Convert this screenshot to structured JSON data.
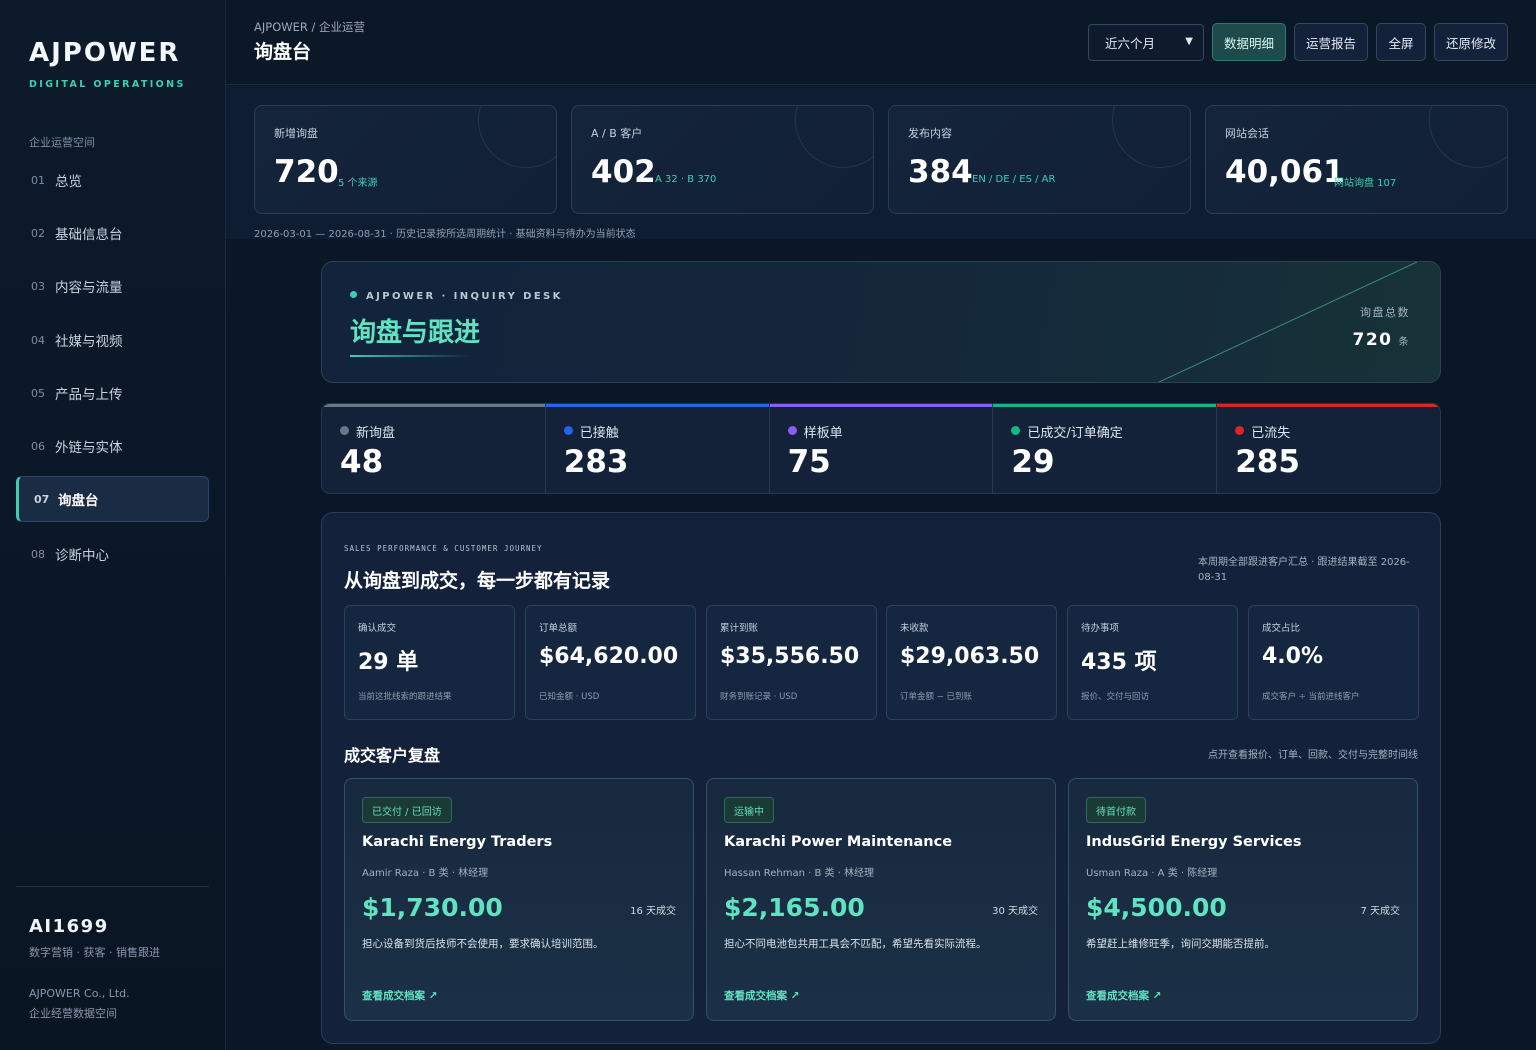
{
  "sidebar": {
    "brand": "AJPOWER",
    "brand_sub": "DIGITAL OPERATIONS",
    "group_label": "企业运营空间",
    "items": [
      {
        "num": "01",
        "label": "总览"
      },
      {
        "num": "02",
        "label": "基础信息台"
      },
      {
        "num": "03",
        "label": "内容与流量"
      },
      {
        "num": "04",
        "label": "社媒与视频"
      },
      {
        "num": "05",
        "label": "产品与上传"
      },
      {
        "num": "06",
        "label": "外链与实体"
      },
      {
        "num": "07",
        "label": "询盘台",
        "active": true
      },
      {
        "num": "08",
        "label": "诊断中心"
      }
    ],
    "user": "AI1699",
    "user_sub": "数字营销 · 获客 · 销售跟进",
    "company": "AJPOWER Co., Ltd.",
    "company_sub": "企业经营数据空间"
  },
  "header": {
    "breadcrumb": "AJPOWER / 企业运营",
    "title": "询盘台",
    "range_select": "近六个月",
    "buttons": [
      "数据明细",
      "运营报告",
      "全屏",
      "还原修改"
    ]
  },
  "stats": [
    {
      "label": "新增询盘",
      "value": "720",
      "sub": "5 个来源"
    },
    {
      "label": "A / B 客户",
      "value": "402",
      "sub": "A 32 · B 370"
    },
    {
      "label": "发布内容",
      "value": "384",
      "sub": "EN / DE / ES / AR"
    },
    {
      "label": "网站会话",
      "value": "40,061",
      "sub": "网站询盘 107"
    }
  ],
  "range_note": "2026-03-01 — 2026-08-31 · 历史记录按所选周期统计 · 基础资料与待办为当前状态",
  "hero": {
    "tag": "AJPOWER · INQUIRY DESK",
    "title": "询盘与跟进",
    "right_label": "询盘总数",
    "right_value": "720",
    "right_unit": "条"
  },
  "pipeline": [
    {
      "label": "新询盘",
      "value": "48",
      "color": "#6b7787"
    },
    {
      "label": "已接触",
      "value": "283",
      "color": "#2563eb"
    },
    {
      "label": "样板单",
      "value": "75",
      "color": "#8b5cf6"
    },
    {
      "label": "已成交/订单确定",
      "value": "29",
      "color": "#10b981"
    },
    {
      "label": "已流失",
      "value": "285",
      "color": "#dc2626"
    }
  ],
  "performance": {
    "eyebrow": "SALES PERFORMANCE & CUSTOMER JOURNEY",
    "title": "从询盘到成交，每一步都有记录",
    "note": "本周期全部跟进客户汇总 · 跟进结果截至 2026-08-31",
    "metrics": [
      {
        "label": "确认成交",
        "value": "29 单",
        "note": "当前这批线索的跟进结果"
      },
      {
        "label": "订单总额",
        "value": "$64,620.00",
        "note": "已知金额 · USD"
      },
      {
        "label": "累计到账",
        "value": "$35,556.50",
        "note": "财务到账记录 · USD"
      },
      {
        "label": "未收款",
        "value": "$29,063.50",
        "note": "订单金额 − 已到账"
      },
      {
        "label": "待办事项",
        "value": "435 项",
        "note": "报价、交付与回访"
      },
      {
        "label": "成交占比",
        "value": "4.0%",
        "note": "成交客户 ÷ 当前进线客户"
      }
    ],
    "section_title": "成交客户复盘",
    "section_note": "点开查看报价、订单、回款、交付与完整时间线",
    "cards": [
      {
        "badge": "已交付 / 已回访",
        "name": "Karachi Energy Traders",
        "meta": "Aamir Raza · B 类 · 林经理",
        "amount": "$1,730.00",
        "days": "16 天成交",
        "desc": "担心设备到货后技师不会使用，要求确认培训范围。",
        "link": "查看成交档案 ↗"
      },
      {
        "badge": "运输中",
        "name": "Karachi Power Maintenance",
        "meta": "Hassan Rehman · B 类 · 林经理",
        "amount": "$2,165.00",
        "days": "30 天成交",
        "desc": "担心不同电池包共用工具会不匹配，希望先看实际流程。",
        "link": "查看成交档案 ↗"
      },
      {
        "badge": "待首付款",
        "name": "IndusGrid Energy Services",
        "meta": "Usman Raza · A 类 · 陈经理",
        "amount": "$4,500.00",
        "days": "7 天成交",
        "desc": "希望赶上维修旺季，询问交期能否提前。",
        "link": "查看成交档案 ↗"
      }
    ]
  }
}
